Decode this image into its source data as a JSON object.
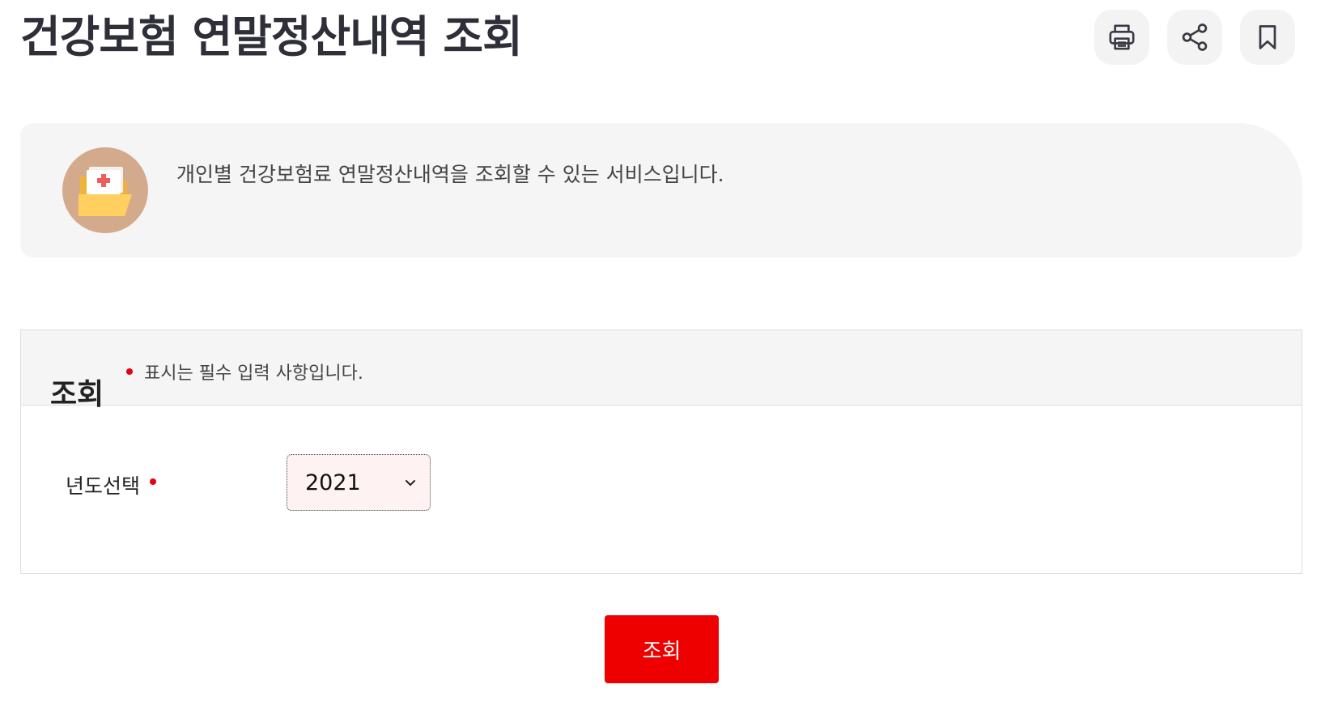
{
  "header": {
    "title": "건강보험 연말정산내역 조회",
    "tools": [
      {
        "name": "print",
        "icon": "printer-icon"
      },
      {
        "name": "share",
        "icon": "share-icon"
      },
      {
        "name": "bookmark",
        "icon": "bookmark-icon"
      }
    ]
  },
  "intro": {
    "icon": "medical-folder-icon",
    "text": "개인별 건강보험료 연말정산내역을 조회할 수 있는 서비스입니다."
  },
  "query": {
    "title": "조회",
    "required_note": "표시는 필수 입력 사항입니다.",
    "year_label": "년도선택",
    "year_value": "2021",
    "submit_label": "조회"
  },
  "colors": {
    "accent_red": "#ee0000",
    "required_dot": "#e60012",
    "title_text": "#2f2f3a",
    "panel_bg": "#f5f5f5",
    "select_bg": "#fff2f2",
    "icon_circle": "#d4aa8c",
    "folder_yellow": "#ffd060"
  }
}
